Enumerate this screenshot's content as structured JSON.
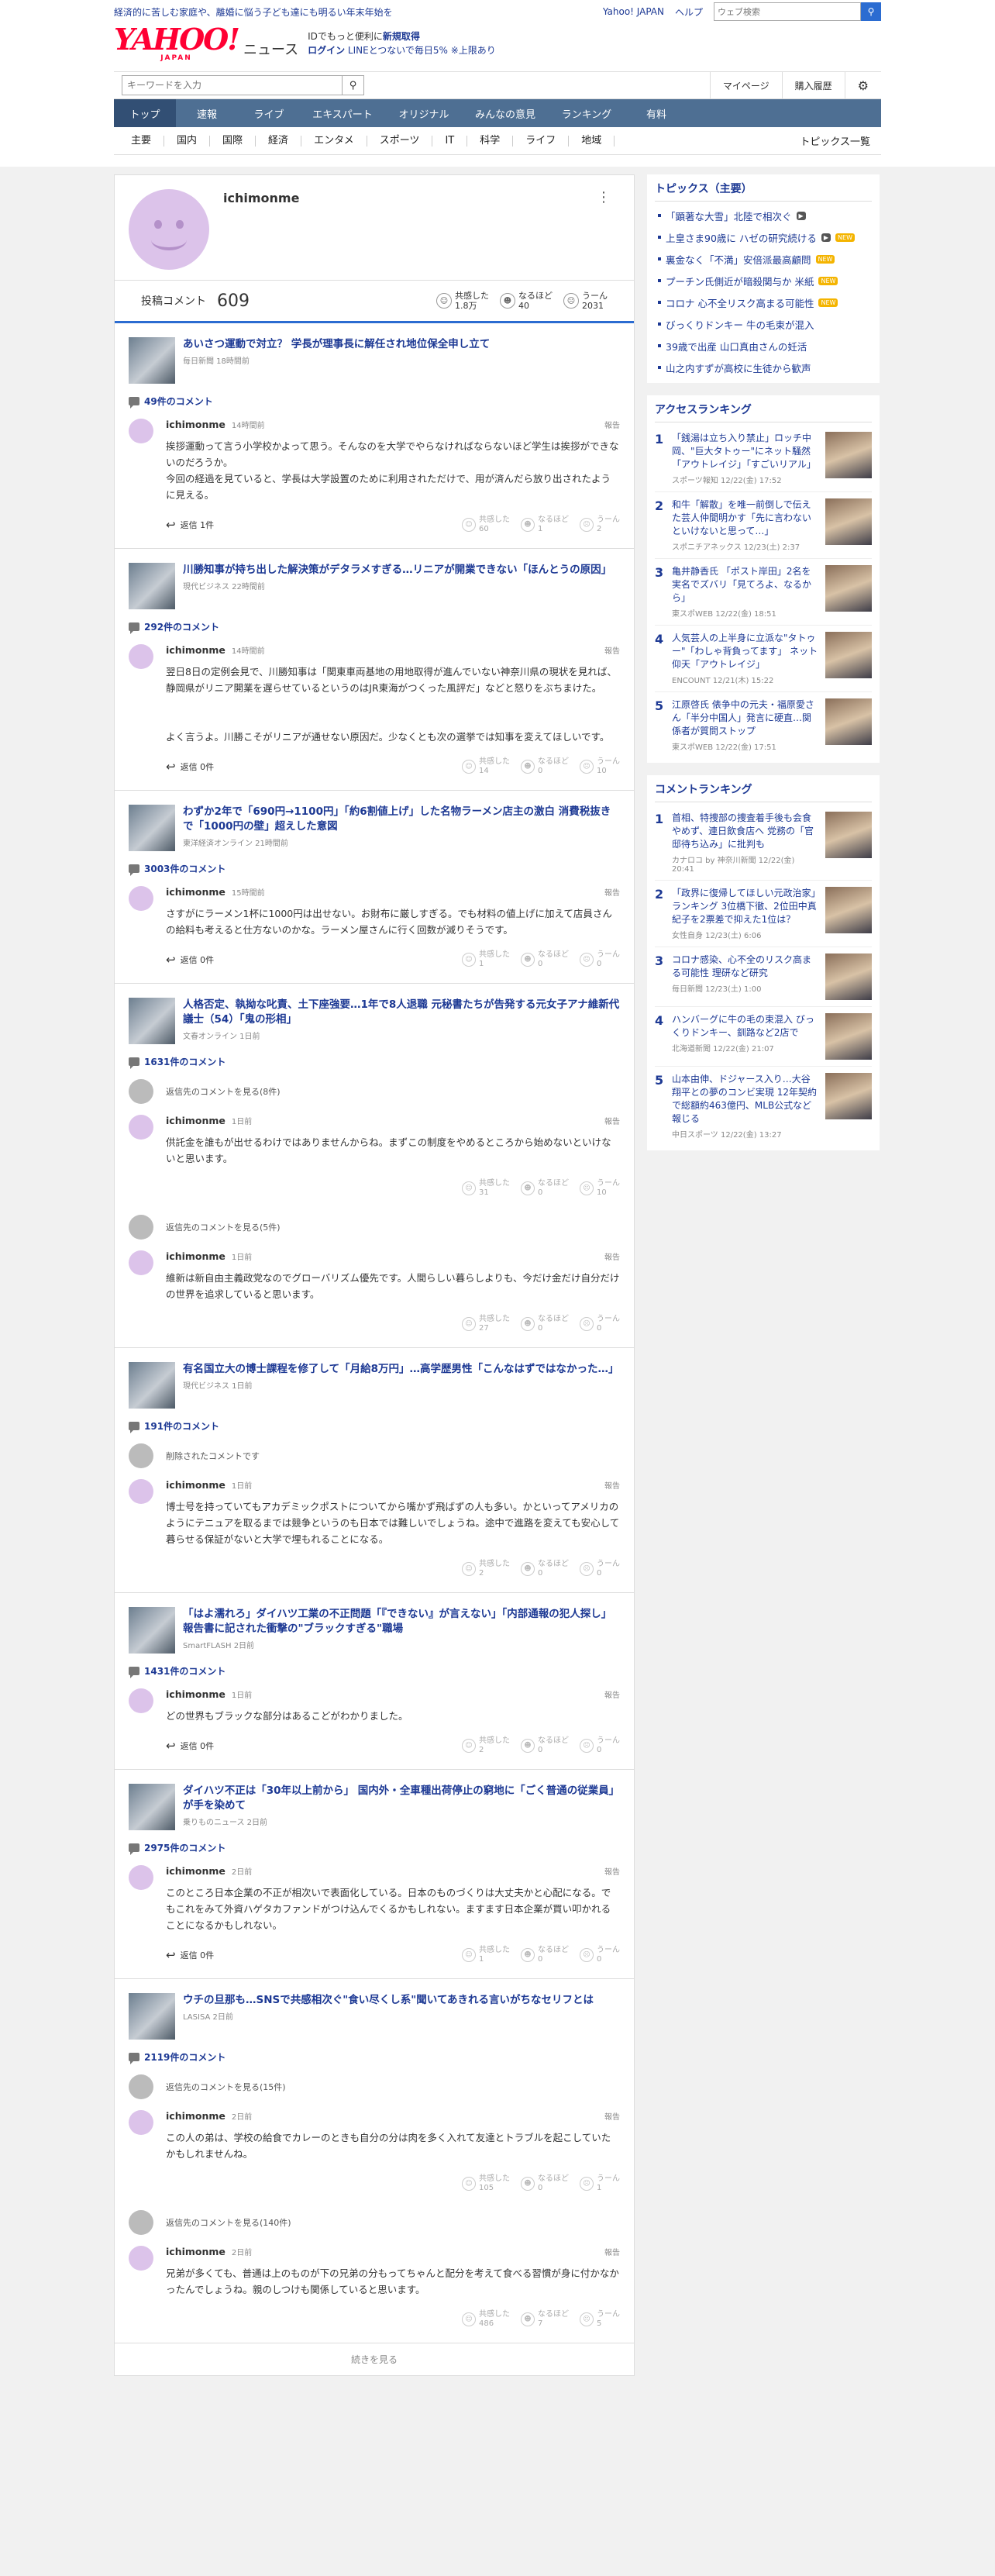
{
  "topbar": {
    "notice": "経済的に苦しむ家庭や、離婚に悩う子ども達にも明るい年末年始を",
    "links": [
      "Yahoo! JAPAN",
      "ヘルプ"
    ],
    "search_placeholder": "ウェブ検索",
    "search_icon": "search-icon"
  },
  "logo": {
    "brand": "YAHOO!",
    "sub": "JAPAN",
    "section": "ニュース"
  },
  "promo": {
    "line1_a": "IDでもっと便利に",
    "line1_b": "新規取得",
    "line2_a": "ログイン",
    "line2_b": "LINEとつないで毎日5% ※上限あり"
  },
  "tools": {
    "keyword_placeholder": "キーワードを入力",
    "mypage": "マイページ",
    "purchase": "購入履歴",
    "gear_icon": "gear-icon"
  },
  "gnav": [
    "トップ",
    "速報",
    "ライブ",
    "エキスパート",
    "オリジナル",
    "みんなの意見",
    "ランキング",
    "有料"
  ],
  "subnav": [
    "主要",
    "国内",
    "国際",
    "経済",
    "エンタメ",
    "スポーツ",
    "IT",
    "科学",
    "ライフ",
    "地域"
  ],
  "subnav_list": "トピックス一覧",
  "profile": {
    "name": "ichimonme",
    "stats_label": "投稿コメント",
    "stats_count": "609",
    "rx": [
      {
        "icon": "empathy-icon",
        "label": "共感した",
        "value": "1.8万"
      },
      {
        "icon": "insight-icon",
        "label": "なるほど",
        "value": "40"
      },
      {
        "icon": "hmm-icon",
        "label": "うーん",
        "value": "2031"
      }
    ]
  },
  "rx_labels": [
    "共感した",
    "なるほど",
    "うーん"
  ],
  "articles": [
    {
      "title": "あいさつ運動で対立？ 学長が理事長に解任され地位保全申し立て",
      "source": "毎日新聞 18時間前",
      "count": "49件のコメント",
      "comments": [
        {
          "user": "ichimonme",
          "time": "14時間前",
          "report": "報告",
          "body": "挨拶運動って言う小学校かよって思う。そんなのを大学でやらなければならないほど学生は挨拶ができないのだろうか。\n今回の経過を見ていると、学長は大学設置のために利用されただけで、用が済んだら放り出されたように見える。",
          "reply": "返信 1件",
          "rx": [
            "60",
            "1",
            "2"
          ]
        }
      ]
    },
    {
      "title": "川勝知事が持ち出した解決策がデタラメすぎる…リニアが開業できない「ほんとうの原因」",
      "source": "現代ビジネス 22時間前",
      "count": "292件のコメント",
      "comments": [
        {
          "user": "ichimonme",
          "time": "14時間前",
          "report": "報告",
          "body": "翌日8日の定例会見で、川勝知事は「関東車両基地の用地取得が進んでいない神奈川県の現状を見れば、静岡県がリニア開業を遅らせているというのはJR東海がつくった風評だ」などと怒りをぶちまけた。\n\n\nよく言うよ。川勝こそがリニアが通せない原因だ。少なくとも次の選挙では知事を変えてほしいです。",
          "reply": "返信 0件",
          "rx": [
            "14",
            "0",
            "10"
          ]
        }
      ]
    },
    {
      "title": "わずか2年で「690円→1100円」「約6割値上げ」した名物ラーメン店主の激白 消費税抜きで「1000円の壁」超えした意図",
      "source": "東洋経済オンライン 21時間前",
      "count": "3003件のコメント",
      "comments": [
        {
          "user": "ichimonme",
          "time": "15時間前",
          "report": "報告",
          "body": "さすがにラーメン1杯に1000円は出せない。お財布に厳しすぎる。でも材料の値上げに加えて店員さんの給料も考えると仕方ないのかな。ラーメン屋さんに行く回数が減りそうです。",
          "reply": "返信 0件",
          "rx": [
            "1",
            "0",
            "0"
          ]
        }
      ]
    },
    {
      "title": "人格否定、執拗な叱責、土下座強要…1年で8人退職 元秘書たちが告発する元女子アナ維新代議士（54）「鬼の形相」",
      "source": "文春オンライン 1日前",
      "count": "1631件のコメント",
      "comments": [
        {
          "view": "返信先のコメントを見る(8件)",
          "user": "ichimonme",
          "time": "1日前",
          "report": "報告",
          "body": "供託金を誰もが出せるわけではありませんからね。まずこの制度をやめるところから始めないといけないと思います。",
          "rx": [
            "31",
            "0",
            "10"
          ]
        },
        {
          "view": "返信先のコメントを見る(5件)",
          "user": "ichimonme",
          "time": "1日前",
          "report": "報告",
          "body": "維新は新自由主義政党なのでグローバリズム優先です。人間らしい暮らしよりも、今だけ金だけ自分だけの世界を追求していると思います。",
          "rx": [
            "27",
            "0",
            "0"
          ]
        }
      ]
    },
    {
      "title": "有名国立大の博士課程を修了して「月給8万円」…高学歴男性「こんなはずではなかった…」",
      "source": "現代ビジネス 1日前",
      "count": "191件のコメント",
      "comments": [
        {
          "deleted": "削除されたコメントです",
          "user": "ichimonme",
          "time": "1日前",
          "report": "報告",
          "body": "博士号を持っていてもアカデミックポストについてから嘴かず飛ばずの人も多い。かといってアメリカのようにテニュアを取るまでは競争というのも日本では難しいでしょうね。途中で進路を変えても安心して暮らせる保証がないと大学で埋もれることになる。",
          "rx": [
            "2",
            "0",
            "0"
          ]
        }
      ]
    },
    {
      "title": "「はよ濡れろ」ダイハツ工業の不正問題「『できない』が言えない」「内部通報の犯人探し」報告書に記された衝撃の\"ブラックすぎる\"職場",
      "source": "SmartFLASH 2日前",
      "count": "1431件のコメント",
      "comments": [
        {
          "user": "ichimonme",
          "time": "1日前",
          "report": "報告",
          "body": "どの世界もブラックな部分はあるこどがわかりました。",
          "reply": "返信 0件",
          "rx": [
            "2",
            "0",
            "0"
          ]
        }
      ]
    },
    {
      "title": "ダイハツ不正は「30年以上前から」 国内外・全車種出荷停止の窮地に「ごく普通の従業員」が手を染めて",
      "source": "乗りものニュース 2日前",
      "count": "2975件のコメント",
      "comments": [
        {
          "user": "ichimonme",
          "time": "2日前",
          "report": "報告",
          "body": "このところ日本企業の不正が相次いで表面化している。日本のものづくりは大丈夫かと心配になる。でもこれをみて外資ハゲタカファンドがつけ込んでくるかもしれない。ますます日本企業が買い叩かれることになるかもしれない。",
          "reply": "返信 0件",
          "rx": [
            "1",
            "0",
            "0"
          ]
        }
      ]
    },
    {
      "title": "ウチの旦那も…SNSで共感相次ぐ\"食い尽くし系\"聞いてあきれる言いがちなセリフとは",
      "source": "LASISA 2日前",
      "count": "2119件のコメント",
      "comments": [
        {
          "view": "返信先のコメントを見る(15件)",
          "user": "ichimonme",
          "time": "2日前",
          "report": "報告",
          "body": "この人の弟は、学校の給食でカレーのときも自分の分は肉を多く入れて友達とトラブルを起こしていたかもしれませんね。",
          "rx": [
            "105",
            "0",
            "1"
          ]
        },
        {
          "view": "返信先のコメントを見る(140件)",
          "user": "ichimonme",
          "time": "2日前",
          "report": "報告",
          "body": "兄弟が多くても、普通は上のものが下の兄弟の分もってちゃんと配分を考えて食べる習慣が身に付かなかったんでしょうね。親のしつけも関係していると思います。",
          "rx": [
            "486",
            "7",
            "5"
          ]
        }
      ]
    }
  ],
  "more_label": "続きを見る",
  "sidebar": {
    "topics_title": "トピックス（主要）",
    "topics": [
      {
        "text": "「顕著な大雪」北陸で相次ぐ",
        "tag": "▶",
        "tag_kind": "cam"
      },
      {
        "text": "上皇さま90歳に ハゼの研究続ける",
        "tag": "NEW",
        "tag_kind": "new",
        "cam": "▶"
      },
      {
        "text": "裏金なく「不満」安倍派最高顧問",
        "tag": "NEW",
        "tag_kind": "new"
      },
      {
        "text": "プーチン氏側近が暗殺関与か 米紙",
        "tag": "NEW",
        "tag_kind": "new"
      },
      {
        "text": "コロナ 心不全リスク高まる可能性",
        "tag": "NEW",
        "tag_kind": "new"
      },
      {
        "text": "びっくりドンキー 牛の毛束が混入",
        "tag": "",
        "tag_kind": ""
      },
      {
        "text": "39歳で出産 山口真由さんの妊活",
        "tag": "",
        "tag_kind": ""
      },
      {
        "text": "山之内すずが高校に生徒から歓声",
        "tag": "",
        "tag_kind": ""
      }
    ],
    "access_title": "アクセスランキング",
    "access": [
      {
        "no": "1",
        "title": "「銭湯は立ち入り禁止」ロッチ中岡、\"巨大タトゥー\"にネット騒然「アウトレイジ」「すごいリアル」",
        "src": "スポーツ報知 12/22(金) 17:52"
      },
      {
        "no": "2",
        "title": "和牛「解散」を唯一前倒しで伝えた芸人仲間明かす「先に言わないといけないと思って…」",
        "src": "スポニチアネックス 12/23(土) 2:37"
      },
      {
        "no": "3",
        "title": "亀井静香氏 「ポスト岸田」2名を実名でズバリ「見てろよ、なるから」",
        "src": "東スポWEB 12/22(金) 18:51"
      },
      {
        "no": "4",
        "title": "人気芸人の上半身に立派な\"タトゥー\"「わしゃ背負ってます」 ネット仰天「アウトレイジ」",
        "src": "ENCOUNT 12/21(木) 15:22"
      },
      {
        "no": "5",
        "title": "江原啓氏 俵争中の元夫・福原愛さん「半分中国人」発言に硬直…関係者が質問ストップ",
        "src": "東スポWEB 12/22(金) 17:51"
      }
    ],
    "comment_title": "コメントランキング",
    "comment_rank": [
      {
        "no": "1",
        "title": "首相、特捜部の捜査着手後も会食やめず、連日飲食店へ 党務の「官邸待ち込み」に批判も",
        "src": "カナロコ by 神奈川新聞 12/22(金) 20:41"
      },
      {
        "no": "2",
        "title": "「政界に復帰してほしい元政治家」ランキング 3位橋下徹、2位田中真紀子を2票差で抑えた1位は？",
        "src": "女性自身 12/23(土) 6:06"
      },
      {
        "no": "3",
        "title": "コロナ感染、心不全のリスク高まる可能性 理研など研究",
        "src": "毎日新聞 12/23(土) 1:00"
      },
      {
        "no": "4",
        "title": "ハンバーグに牛の毛の束混入 びっくりドンキー、釧路など2店で",
        "src": "北海道新聞 12/22(金) 21:07"
      },
      {
        "no": "5",
        "title": "山本由伸、ドジャース入り…大谷翔平との夢のコンビ実現 12年契約で総額約463億円、MLB公式など報じる",
        "src": "中日スポーツ 12/22(金) 13:27"
      }
    ]
  }
}
